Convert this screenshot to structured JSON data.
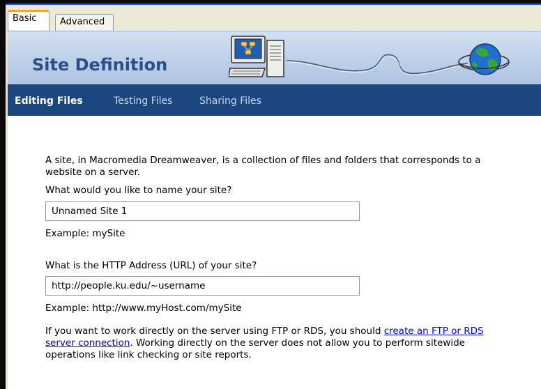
{
  "tabs": [
    {
      "label": "Basic",
      "active": true
    },
    {
      "label": "Advanced",
      "active": false
    }
  ],
  "header": {
    "title": "Site Definition"
  },
  "nav": {
    "items": [
      {
        "label": "Editing Files",
        "active": true
      },
      {
        "label": "Testing Files",
        "active": false
      },
      {
        "label": "Sharing Files",
        "active": false
      }
    ]
  },
  "content": {
    "intro_line1": "A site, in Macromedia Dreamweaver, is a collection of files and folders that corresponds to a",
    "intro_line2": "website on a server.",
    "name_question": "What would you like to name your site?",
    "name_value": "Unnamed Site 1",
    "name_example": "Example: mySite",
    "url_question": "What is the HTTP Address (URL) of your site?",
    "url_value": "http://people.ku.edu/~username",
    "url_example": "Example: http://www.myHost.com/mySite",
    "ftp_line1_prefix": "If you want to work directly on the server using FTP or RDS, you should ",
    "ftp_link_part1": "create an FTP or RDS",
    "ftp_link_part2": "server connection",
    "ftp_line2_suffix": ".  Working directly on the server does not allow you to perform sitewide",
    "ftp_line3": "operations like link checking or site reports."
  },
  "colors": {
    "nav_bg": "#1c4680",
    "header_title": "#2a4e85",
    "link": "#0000ee",
    "active_tab_accent": "#f5a437"
  },
  "icons": [
    "computer-icon",
    "globe-icon"
  ]
}
